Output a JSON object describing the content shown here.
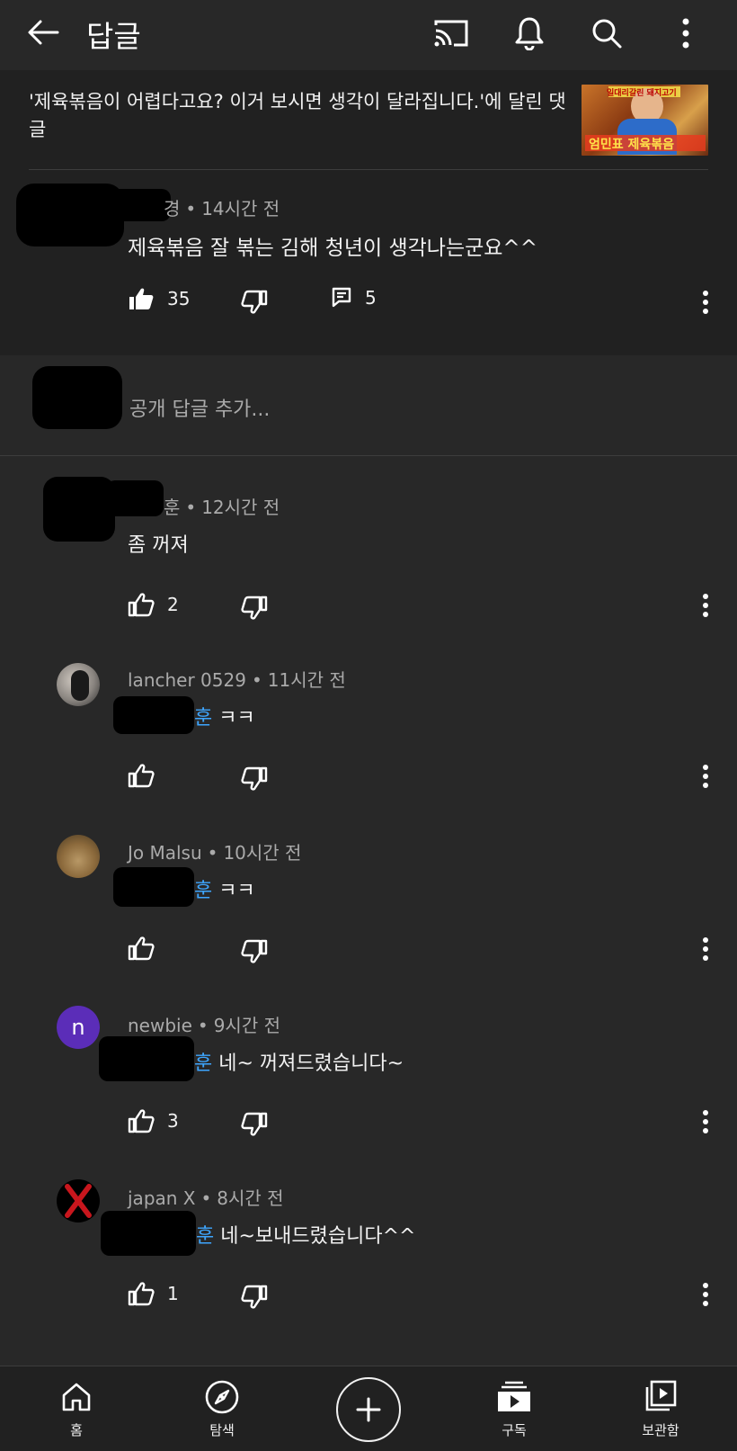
{
  "topbar": {
    "title": "답글"
  },
  "video": {
    "caption": "'제육볶음이 어렵다고요? 이거 보시면 생각이 달라집니다.'에 달린 댓글",
    "thumb_text_top": "일대리갈린 돼지고기",
    "thumb_text_bottom": "엄민표 제육볶음"
  },
  "parent_comment": {
    "author_suffix": "경",
    "time": "14시간 전",
    "text": "제육볶음 잘 볶는 김해 청년이 생각나는군요^^",
    "likes": "35",
    "replies": "5"
  },
  "add_reply": {
    "placeholder": "공개 답글 추가..."
  },
  "replies": [
    {
      "author": "훈",
      "time": "12시간 전",
      "mention": "",
      "text": "좀 꺼져",
      "likes": "2"
    },
    {
      "author": "lancher 0529",
      "time": "11시간 전",
      "mention": "훈",
      "text": " ㅋㅋ",
      "likes": ""
    },
    {
      "author": "Jo Malsu",
      "time": "10시간 전",
      "mention": "훈",
      "text": " ㅋㅋ",
      "likes": ""
    },
    {
      "author": "newbie",
      "time": "9시간 전",
      "mention": "훈",
      "text": " 네~ 꺼져드렸습니다~",
      "likes": "3",
      "avatar_letter": "n"
    },
    {
      "author": "japan X",
      "time": "8시간 전",
      "mention": "훈",
      "text": " 네~보내드렸습니다^^",
      "likes": "1"
    }
  ],
  "separator_dot": "•",
  "bottom_nav": {
    "home": "홈",
    "explore": "탐색",
    "subscriptions": "구독",
    "library": "보관함"
  },
  "colors": {
    "background": "#282828",
    "header_bg": "#212121",
    "mention": "#3ea6ff",
    "newbie_avatar": "#5b2db8"
  }
}
